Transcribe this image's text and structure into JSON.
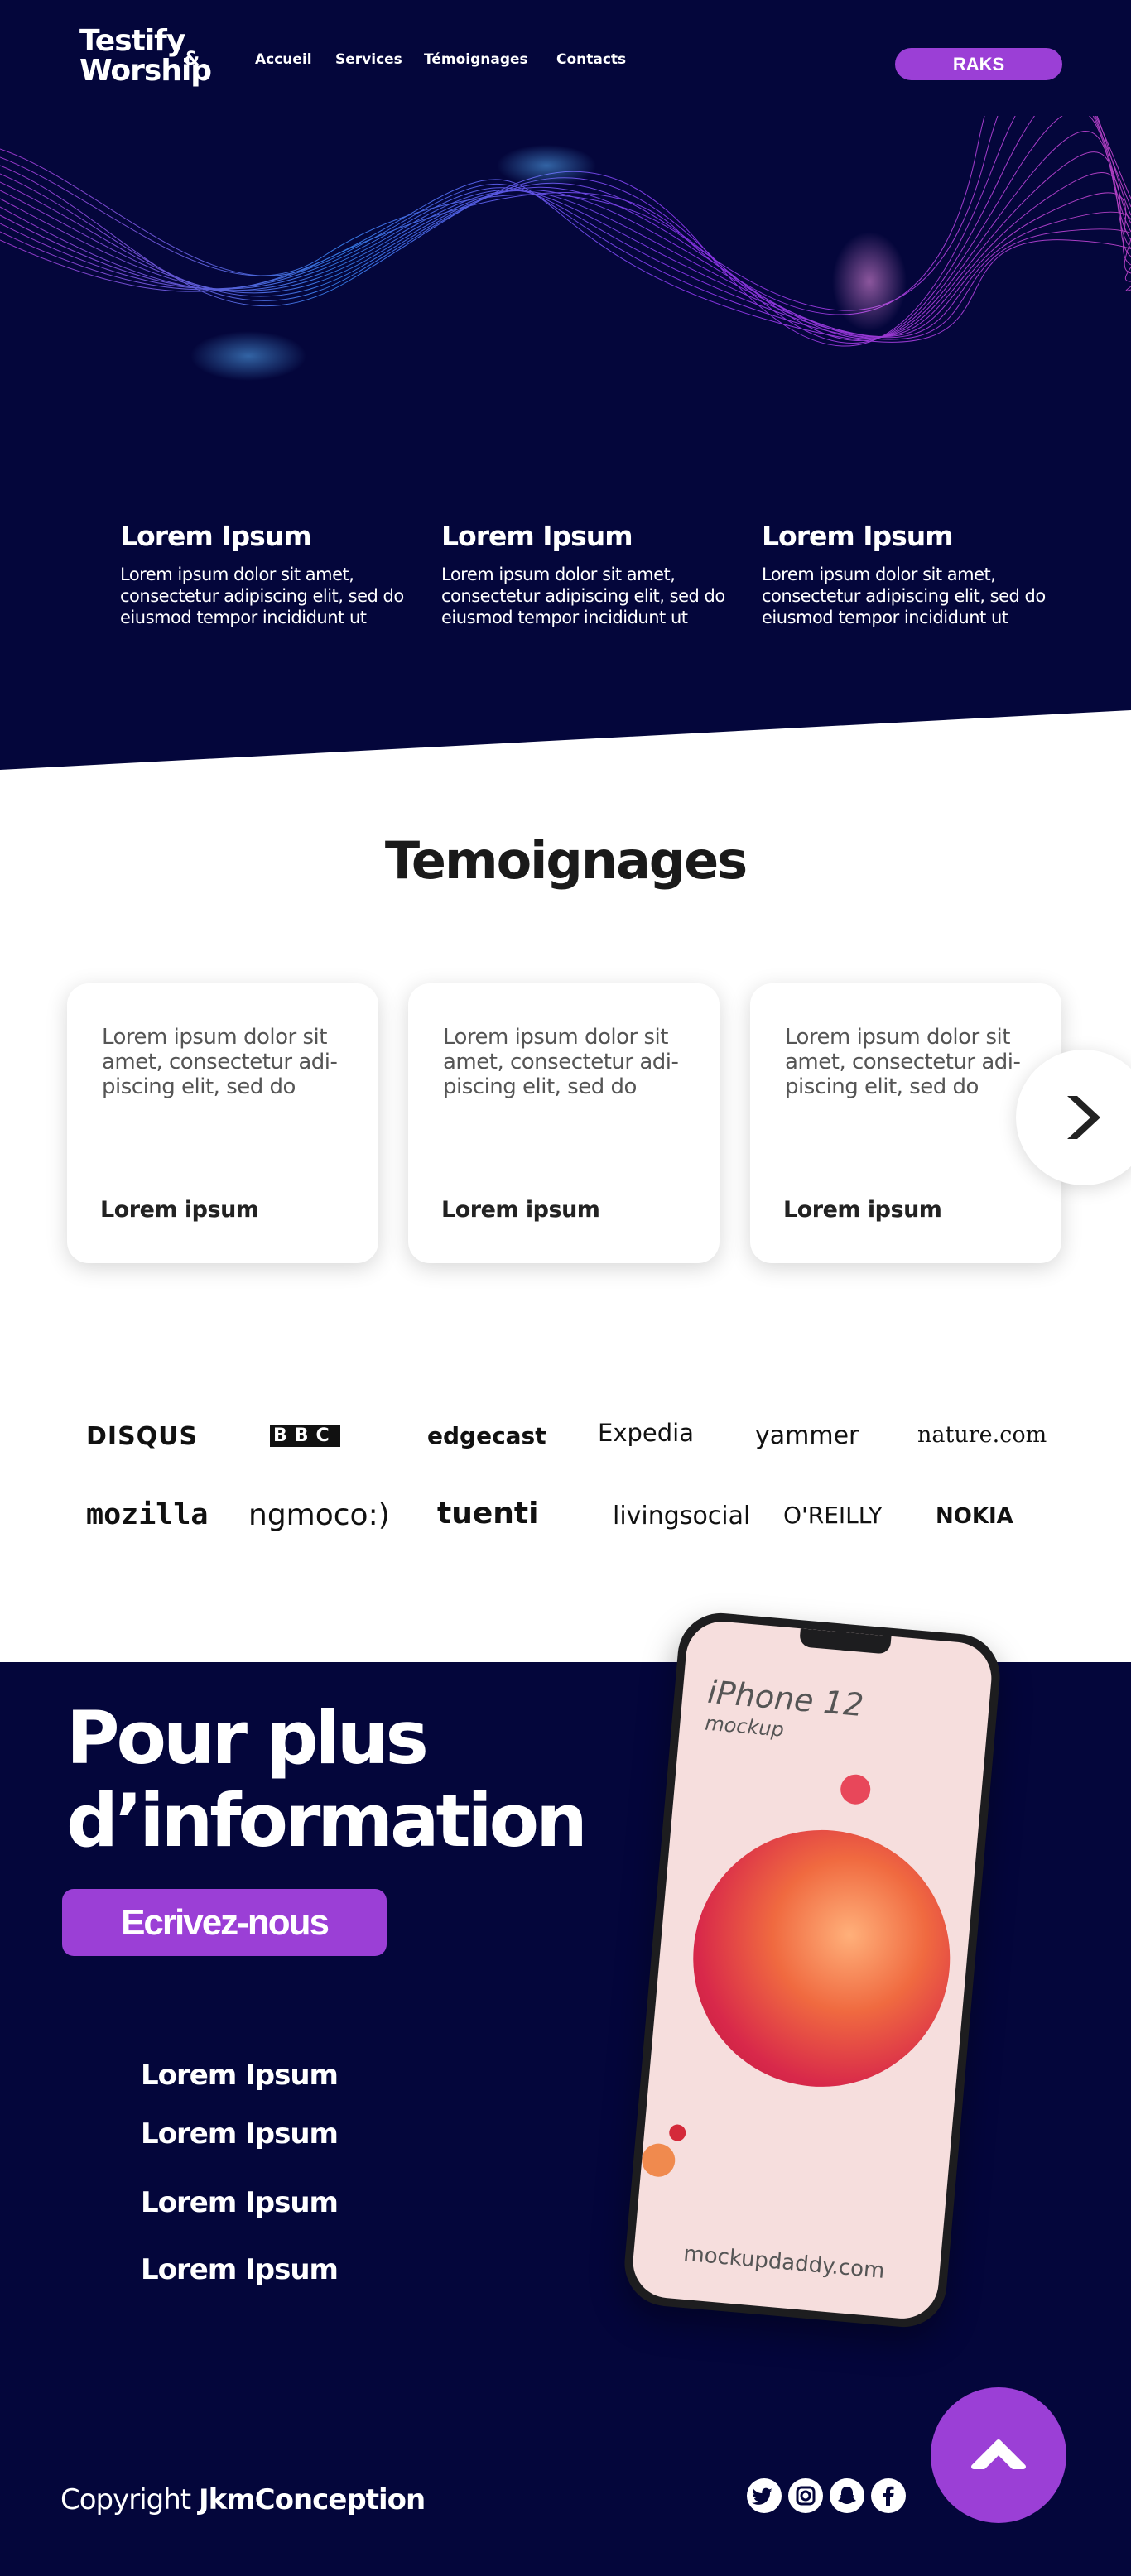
{
  "header": {
    "logo_line1": "Testify",
    "logo_amp": "&",
    "logo_line2": "Worship",
    "nav": [
      "Accueil",
      "Services",
      "Témoignages",
      "Contacts"
    ],
    "cta": "RAKS"
  },
  "features": [
    {
      "title": "Lorem Ipsum",
      "text": "Lorem ipsum dolor sit amet, consectetur adipiscing elit, sed do eiusmod tempor incididunt ut"
    },
    {
      "title": "Lorem Ipsum",
      "text": "Lorem ipsum dolor sit amet, consectetur adipiscing elit, sed do eiusmod tempor incididunt ut"
    },
    {
      "title": "Lorem Ipsum",
      "text": "Lorem ipsum dolor sit amet, consectetur adipiscing elit, sed do eiusmod tempor incididunt ut"
    }
  ],
  "testimonials": {
    "title": "Temoignages",
    "cards": [
      {
        "text": "Lorem ipsum dolor sit amet, consectetur adi-piscing elit, sed do",
        "author": "Lorem ipsum"
      },
      {
        "text": "Lorem ipsum dolor sit amet, consectetur adi-piscing elit, sed do",
        "author": "Lorem ipsum"
      },
      {
        "text": "Lorem ipsum dolor sit amet, consectetur adi-piscing elit, sed do",
        "author": "Lorem ipsum"
      }
    ]
  },
  "brands": [
    "DISQUS",
    "BBC",
    "edgecast",
    "Expedia",
    "yammer",
    "nature.com",
    "mozilla",
    "ngmoco:)",
    "tuenti",
    "livingsocial",
    "O'REILLY",
    "NOKIA"
  ],
  "info": {
    "heading_line1": "Pour plus",
    "heading_line2": "d’information",
    "cta": "Ecrivez-nous",
    "links": [
      "Lorem Ipsum",
      "Lorem Ipsum",
      "Lorem Ipsum",
      "Lorem Ipsum"
    ],
    "phone_title": "iPhone 12",
    "phone_subtitle": "mockup",
    "phone_footer": "mockupdaddy.com"
  },
  "footer": {
    "copyright_prefix": "Copyright",
    "copyright_brand": "JkmConception",
    "social_icons": [
      "twitter-icon",
      "instagram-icon",
      "snapchat-icon",
      "facebook-icon"
    ]
  },
  "colors": {
    "navy": "#04063b",
    "accent": "#9b3fd6"
  }
}
